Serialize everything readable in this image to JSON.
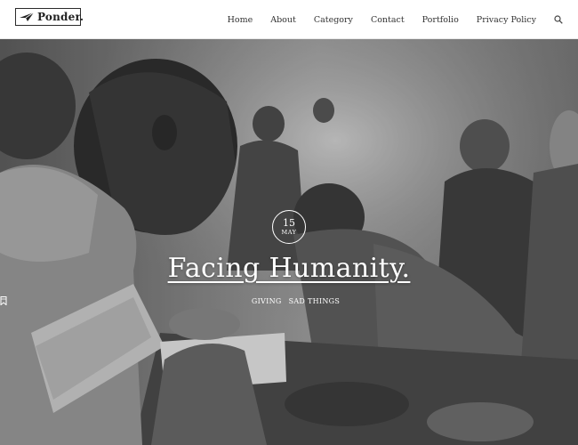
{
  "header": {
    "logo_text": "Ponder.",
    "nav": [
      {
        "label": "Home"
      },
      {
        "label": "About"
      },
      {
        "label": "Category"
      },
      {
        "label": "Contact"
      },
      {
        "label": "Portfolio"
      },
      {
        "label": "Privacy Policy"
      }
    ],
    "search_icon": "search-icon"
  },
  "hero": {
    "date_day": "15",
    "date_month": "MAY",
    "title": "Facing Humanity.",
    "categories": [
      "GIVING",
      "SAD THINGS"
    ],
    "meta_icon": "bookmark-icon"
  }
}
